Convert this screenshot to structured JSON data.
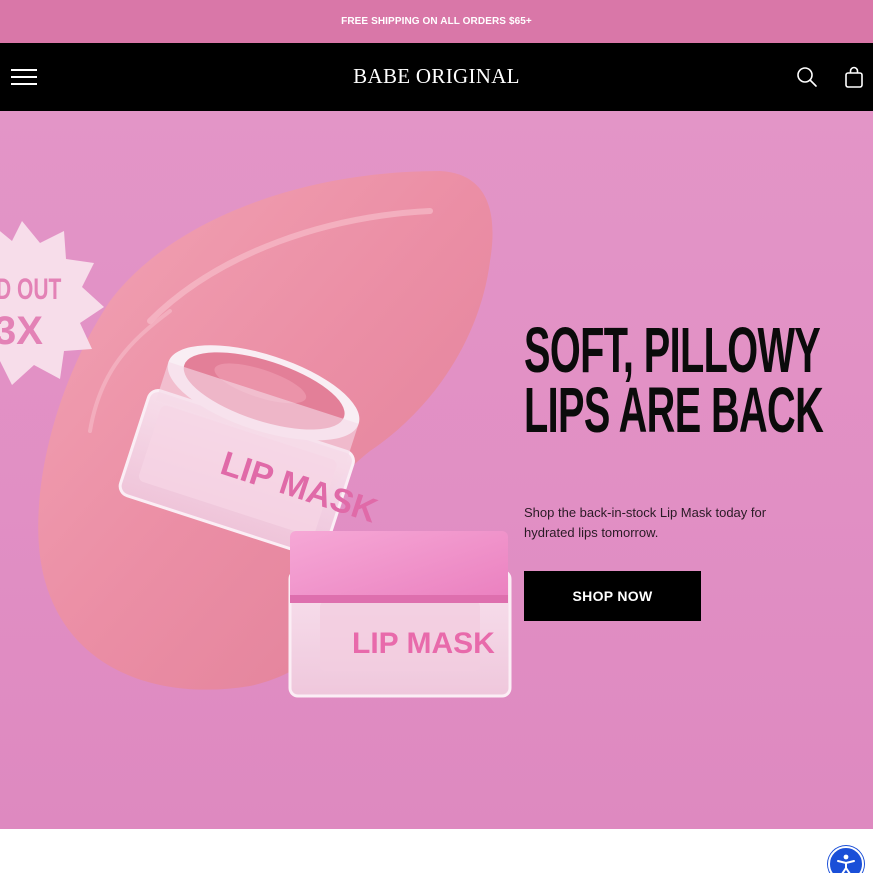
{
  "announcement": {
    "text": "FREE SHIPPING ON ALL ORDERS $65+"
  },
  "header": {
    "logo": "BABE ORIGINAL",
    "icons": [
      "menu-icon",
      "search-icon",
      "cart-icon"
    ]
  },
  "hero": {
    "headline_line1": "SOFT, PILLOWY",
    "headline_line2": "LIPS ARE BACK",
    "subtext": "Shop the back-in-stock Lip Mask today for hydrated lips tomorrow.",
    "cta_label": "SHOP NOW",
    "badge_line1": "D OUT",
    "badge_line2": "3X",
    "jar_label_top": "LIP MASK",
    "jar_label_bottom": "LIP MASK"
  },
  "colors": {
    "announcement_bg": "#d977a8",
    "header_bg": "#000000",
    "hero_bg": "#e18fc4",
    "cta_bg": "#000000",
    "accent_pink": "#e382b6"
  },
  "accessibility": {
    "icon": "accessibility-icon"
  }
}
